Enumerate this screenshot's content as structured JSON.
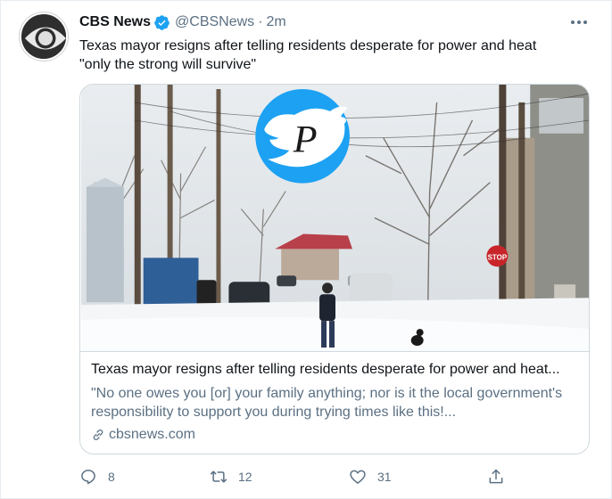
{
  "tweet": {
    "author_name": "CBS News",
    "handle": "@CBSNews",
    "separator": "·",
    "time": "2m",
    "text_line1": "Texas mayor resigns after telling residents desperate for power and heat",
    "text_line2": "\"only the strong will survive\""
  },
  "card": {
    "title": "Texas mayor resigns after telling residents desperate for power and heat...",
    "description": "\"No one owes you [or] your family anything; nor is it the local government's responsibility to support you during trying times like this!...",
    "domain": "cbsnews.com",
    "stop_sign_text": "STOP",
    "watermark_letter": "P"
  },
  "actions": {
    "reply_count": "8",
    "retweet_count": "12",
    "like_count": "31"
  },
  "colors": {
    "accent": "#1da1f2",
    "secondary_text": "#5b7083",
    "border": "#cfd9de"
  },
  "icons": [
    "cbs-eye-logo",
    "verified-badge-icon",
    "more-icon",
    "link-icon",
    "reply-icon",
    "retweet-icon",
    "like-icon",
    "share-icon"
  ]
}
